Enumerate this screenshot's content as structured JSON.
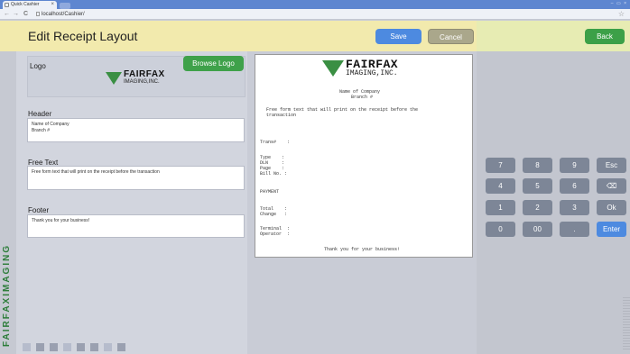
{
  "browser": {
    "tab_title": "Quick Cashier",
    "tab_close": "×",
    "url": "localhost/Cashier/",
    "win_buttons": "– ▭ ×"
  },
  "header": {
    "title": "Edit Receipt Layout",
    "save": "Save",
    "cancel": "Cancel",
    "back": "Back"
  },
  "sidebar": {
    "brand": "FAIRFAXIMAGING"
  },
  "form": {
    "logo_label": "Logo",
    "browse_logo": "Browse Logo",
    "header_label": "Header",
    "header_text": "Name of Company\nBranch #",
    "freetext_label": "Free Text",
    "freetext_text": "Free form text that will print on the receipt before the transaction",
    "footer_label": "Footer",
    "footer_text": "Thank you for your business!"
  },
  "logo": {
    "line1": "FAIRFAX",
    "line2": "IMAGING,INC."
  },
  "receipt": {
    "company": "Name of Company",
    "branch": "Branch #",
    "free_text": "Free form text that will print on the receipt before the\ntransaction",
    "trans": "Trans#    :",
    "type_lines": "Type    :\nDLN     :\nPage    :\nBill No. :",
    "payment": "PAYMENT",
    "totals": "Total    :\nChange   :",
    "terminal": "Terminal  :\nOperator  :",
    "footer": "Thank you for your business!"
  },
  "keypad": {
    "k7": "7",
    "k8": "8",
    "k9": "9",
    "esc": "Esc",
    "k4": "4",
    "k5": "5",
    "k6": "6",
    "backspace": "⌫",
    "k1": "1",
    "k2": "2",
    "k3": "3",
    "ok": "Ok",
    "k0": "0",
    "k00": "00",
    "dot": ".",
    "enter": "Enter"
  },
  "colors": {
    "accent_blue": "#4d8ae0",
    "accent_green": "#3fa14a",
    "header_bg": "#f2eaad"
  }
}
